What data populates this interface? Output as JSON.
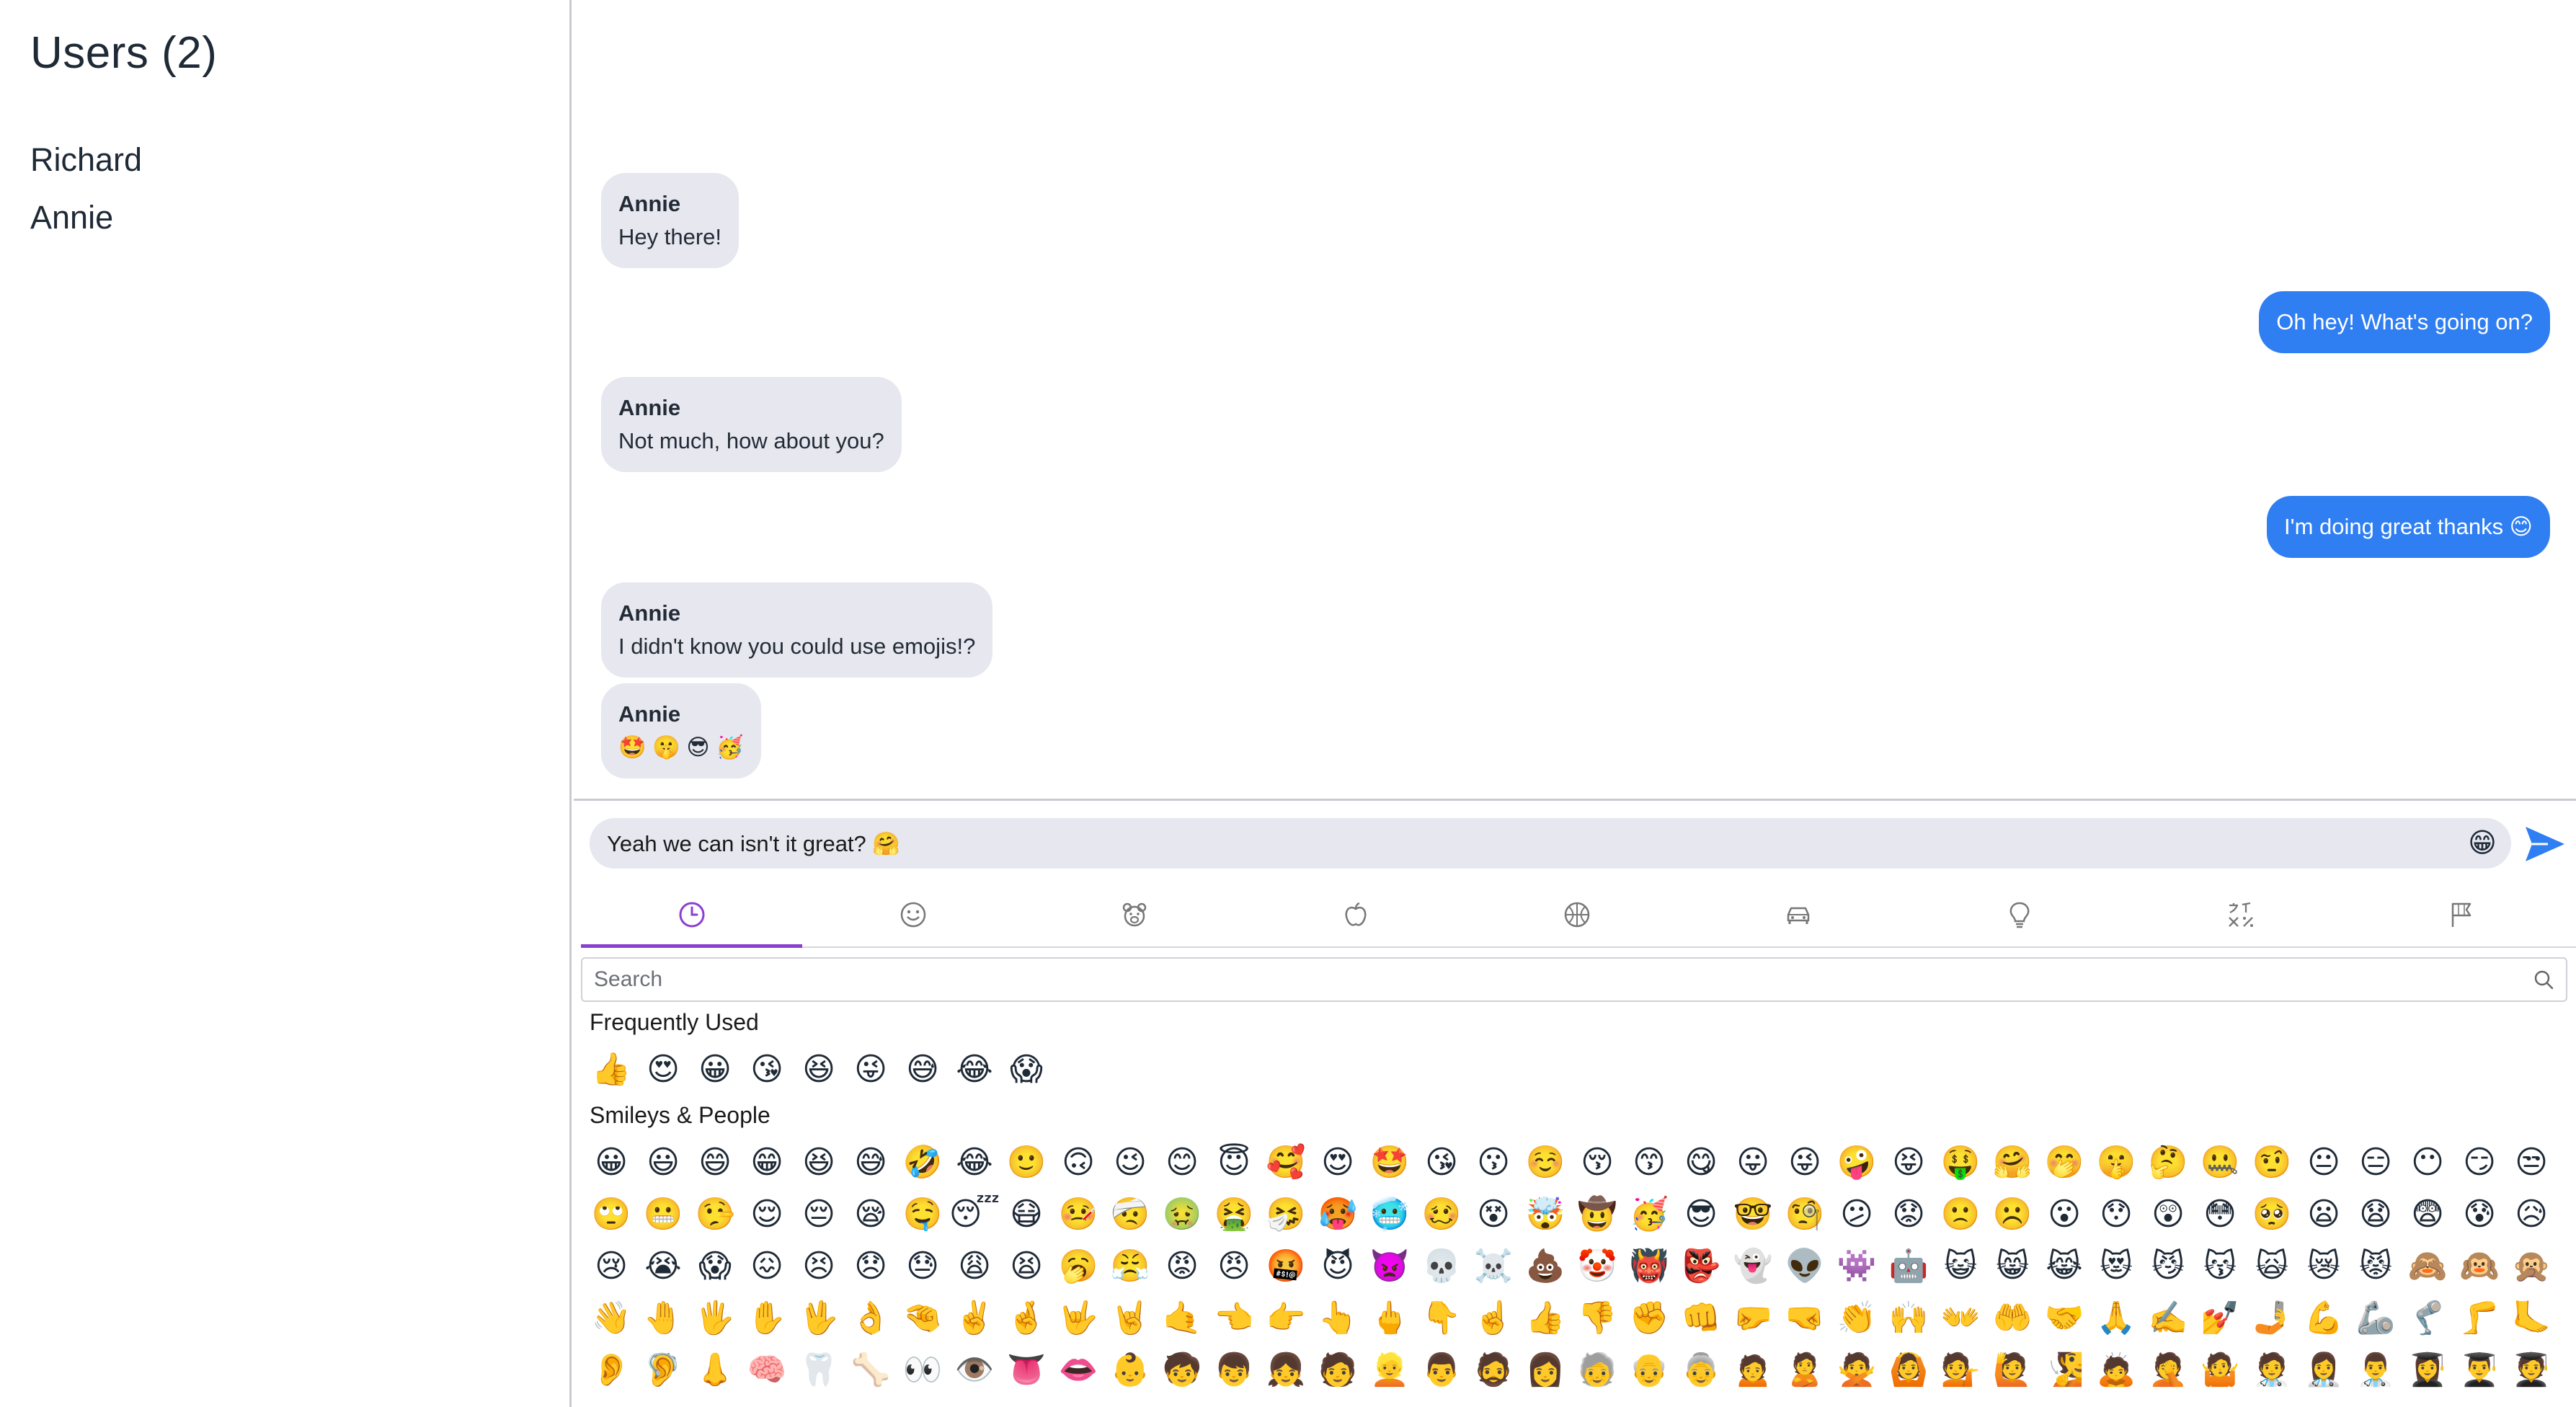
{
  "sidebar": {
    "title": "Users (2)",
    "users": [
      "Richard",
      "Annie"
    ]
  },
  "messages": [
    {
      "direction": "in",
      "from": "Annie",
      "text": "Hey there!"
    },
    {
      "direction": "out",
      "text": "Oh hey! What's going on?"
    },
    {
      "direction": "in",
      "from": "Annie",
      "text": "Not much, how about you?"
    },
    {
      "direction": "out",
      "text": "I'm doing great thanks 😊"
    },
    {
      "direction": "in",
      "from": "Annie",
      "text": "I didn't know you could use emojis!?"
    },
    {
      "direction": "in",
      "from": "Annie",
      "text": "🤩 🤫 😎 🥳"
    }
  ],
  "composer": {
    "value": "Yeah we can isn't it great? 🤗",
    "emoji_toggle": "😁",
    "send_icon": "send-icon"
  },
  "picker": {
    "tabs": [
      {
        "name": "recent",
        "icon": "clock-icon"
      },
      {
        "name": "smileys",
        "icon": "smiley-icon"
      },
      {
        "name": "animals",
        "icon": "bear-icon"
      },
      {
        "name": "food",
        "icon": "apple-icon"
      },
      {
        "name": "activity",
        "icon": "ball-icon"
      },
      {
        "name": "travel",
        "icon": "car-icon"
      },
      {
        "name": "objects",
        "icon": "lightbulb-icon"
      },
      {
        "name": "symbols",
        "icon": "symbols-icon"
      },
      {
        "name": "flags",
        "icon": "flag-icon"
      }
    ],
    "active_tab": "recent",
    "accent_color": "#8b3fd1",
    "search_placeholder": "Search",
    "frequently_used_title": "Frequently Used",
    "frequently_used": [
      "👍",
      "😍",
      "😀",
      "😘",
      "😆",
      "😜",
      "😅",
      "😂",
      "😱"
    ],
    "smileys_title": "Smileys & People",
    "smileys_rows": [
      [
        "😀",
        "😃",
        "😄",
        "😁",
        "😆",
        "😅",
        "🤣",
        "😂",
        "🙂",
        "🙃",
        "😉",
        "😊",
        "😇",
        "🥰",
        "😍",
        "🤩",
        "😘",
        "😗",
        "☺️",
        "😚",
        "😙",
        "😋",
        "😛",
        "😜",
        "🤪",
        "😝",
        "🤑",
        "🤗",
        "🤭",
        "🤫",
        "🤔",
        "🤐",
        "🤨",
        "😐",
        "😑",
        "😶",
        "😏",
        "😒"
      ],
      [
        "🙄",
        "😬",
        "🤥",
        "😌",
        "😔",
        "😪",
        "🤤",
        "😴",
        "😷",
        "🤒",
        "🤕",
        "🤢",
        "🤮",
        "🤧",
        "🥵",
        "🥶",
        "🥴",
        "😵",
        "🤯",
        "🤠",
        "🥳",
        "😎",
        "🤓",
        "🧐",
        "😕",
        "😟",
        "🙁",
        "☹️",
        "😮",
        "😯",
        "😲",
        "😳",
        "🥺",
        "😦",
        "😧",
        "😨",
        "😰",
        "😥"
      ],
      [
        "😢",
        "😭",
        "😱",
        "😖",
        "😣",
        "😞",
        "😓",
        "😩",
        "😫",
        "🥱",
        "😤",
        "😡",
        "😠",
        "🤬",
        "😈",
        "👿",
        "💀",
        "☠️",
        "💩",
        "🤡",
        "👹",
        "👺",
        "👻",
        "👽",
        "👾",
        "🤖",
        "😺",
        "😸",
        "😹",
        "😻",
        "😼",
        "😽",
        "🙀",
        "😿",
        "😾",
        "🙈",
        "🙉",
        "🙊"
      ],
      [
        "👋",
        "🤚",
        "🖐️",
        "✋",
        "🖖",
        "👌",
        "🤏",
        "✌️",
        "🤞",
        "🤟",
        "🤘",
        "🤙",
        "👈",
        "👉",
        "👆",
        "🖕",
        "👇",
        "☝️",
        "👍",
        "👎",
        "✊",
        "👊",
        "🤛",
        "🤜",
        "👏",
        "🙌",
        "👐",
        "🤲",
        "🤝",
        "🙏",
        "✍️",
        "💅",
        "🤳",
        "💪",
        "🦾",
        "🦿",
        "🦵",
        "🦶"
      ],
      [
        "👂",
        "🦻",
        "👃",
        "🧠",
        "🦷",
        "🦴",
        "👀",
        "👁️",
        "👅",
        "👄",
        "👶",
        "🧒",
        "👦",
        "👧",
        "🧑",
        "👱",
        "👨",
        "🧔",
        "👩",
        "🧓",
        "👴",
        "👵",
        "🙍",
        "🙎",
        "🙅",
        "🙆",
        "💁",
        "🙋",
        "🧏",
        "🙇",
        "🤦",
        "🤷",
        "🧑‍⚕️",
        "👩‍⚕️",
        "👨‍⚕️",
        "👩‍🎓",
        "👨‍🎓",
        "🧑‍🎓"
      ]
    ]
  }
}
